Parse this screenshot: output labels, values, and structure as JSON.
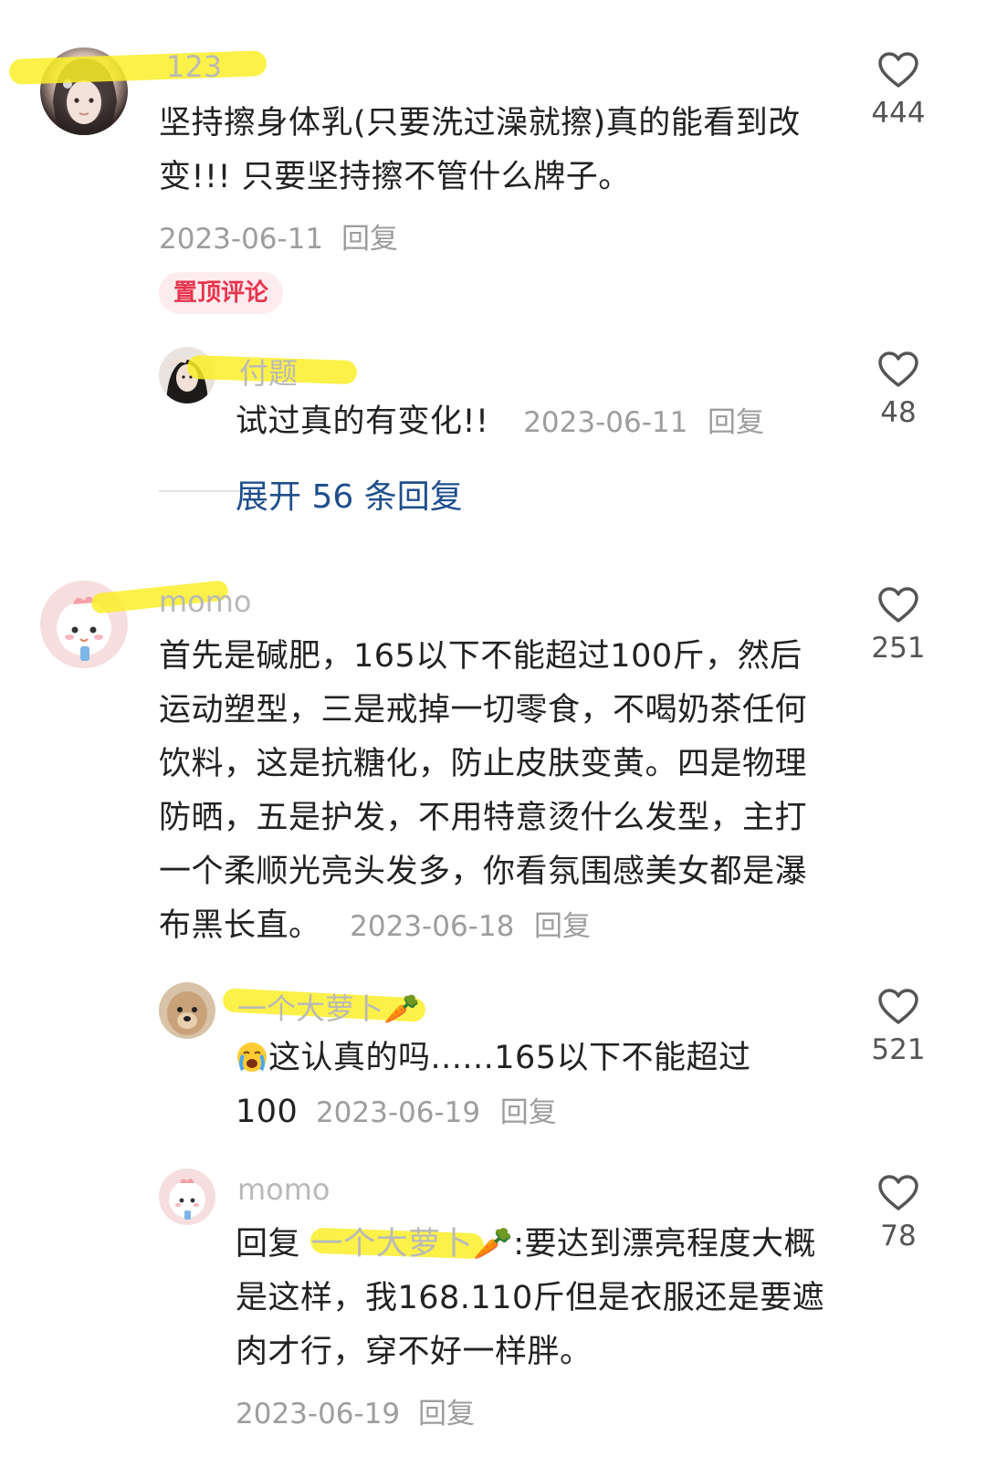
{
  "comments": [
    {
      "username": "123",
      "text": "坚持擦身体乳(只要洗过澡就擦)真的能看到改变!!! 只要坚持擦不管什么牌子。",
      "date": "2023-06-11",
      "reply_label": "回复",
      "likes": "444",
      "pinned_label": "置顶评论",
      "replies": [
        {
          "username": "付题",
          "text": "试过真的有变化!!",
          "date": "2023-06-11",
          "reply_label": "回复",
          "likes": "48"
        }
      ],
      "expand_label": "展开 56 条回复"
    },
    {
      "username": "momo",
      "text": "首先是碱肥，165以下不能超过100斤，然后运动塑型，三是戒掉一切零食，不喝奶茶任何饮料，这是抗糖化，防止皮肤变黄。四是物理防晒，五是护发，不用特意烫什么发型，主打一个柔顺光亮头发多，你看氛围感美女都是瀑布黑长直。",
      "date": "2023-06-18",
      "reply_label": "回复",
      "likes": "251",
      "replies": [
        {
          "username": "一个大萝卜🥕",
          "text": "这认真的吗......165以下不能超过100",
          "date": "2023-06-19",
          "reply_label": "回复",
          "likes": "521"
        },
        {
          "username": "momo",
          "reply_prefix": "回复",
          "reply_to": "一个大萝卜🥕",
          "text": ":要达到漂亮程度大概是这样，我168.110斤但是衣服还是要遮肉才行，穿不好一样胖。",
          "date": "2023-06-19",
          "reply_label": "回复",
          "likes": "78"
        }
      ]
    }
  ],
  "icons": {
    "like": "heart-outline-icon",
    "crying": "crying-face-emoji",
    "carrot": "carrot-emoji"
  },
  "colors": {
    "highlight": "#faee28",
    "pinned": "#e8344e",
    "link": "#1f4f8c"
  }
}
